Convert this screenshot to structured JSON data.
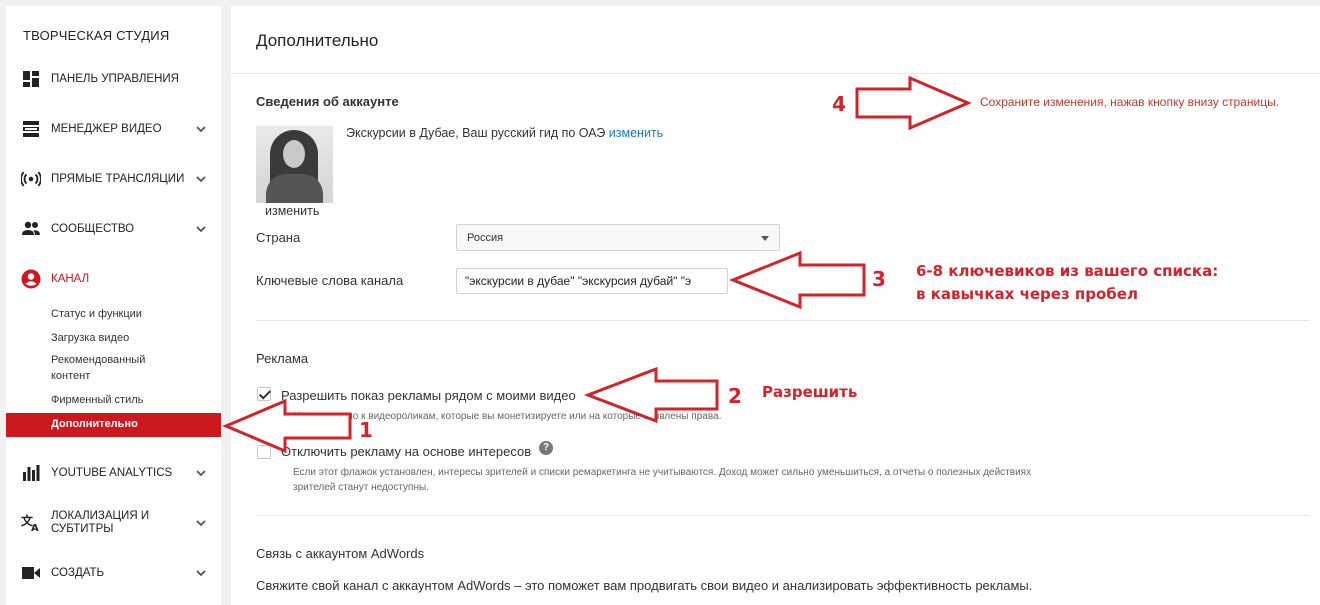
{
  "sidebar": {
    "studio_title": "ТВОРЧЕСКАЯ СТУДИЯ",
    "items": [
      {
        "label": "ПАНЕЛЬ УПРАВЛЕНИЯ",
        "icon": "dashboard-icon"
      },
      {
        "label": "МЕНЕДЖЕР ВИДЕО",
        "icon": "video-manager-icon"
      },
      {
        "label": "ПРЯМЫЕ ТРАНСЛЯЦИИ",
        "icon": "live-broadcast-icon"
      },
      {
        "label": "СООБЩЕСТВО",
        "icon": "community-icon"
      },
      {
        "label": "КАНАЛ",
        "icon": "channel-icon"
      },
      {
        "label": "YOUTUBE ANALYTICS",
        "icon": "analytics-icon"
      },
      {
        "label": "ЛОКАЛИЗАЦИЯ И СУБТИТРЫ",
        "icon": "translate-icon"
      },
      {
        "label": "СОЗДАТЬ",
        "icon": "create-video-icon"
      }
    ],
    "channel_subitems": [
      "Статус и функции",
      "Загрузка видео",
      "Рекомендованный контент",
      "Фирменный стиль"
    ],
    "active_subitem": "Дополнительно"
  },
  "main": {
    "page_title": "Дополнительно",
    "account_section_title": "Сведения об аккаунте",
    "channel_name": "Экскурсии в Дубае, Ваш русский гид по ОАЭ",
    "change_link": "изменить",
    "avatar_change_link": "изменить",
    "country_label": "Страна",
    "country_value": "Россия",
    "keywords_label": "Ключевые слова канала",
    "keywords_value": "\"экскурсии в дубае\" \"экскурсия дубай\" \"э",
    "ads_section_title": "Реклама",
    "allow_ads_label": "Разрешить показ рекламы рядом с моими видео",
    "allow_ads_checked": true,
    "allow_ads_note": "Неприменимо к видеороликам, которые вы монетизируете или на которые заявлены права.",
    "interest_ads_label": "Отключить рекламу на основе интересов",
    "interest_ads_checked": false,
    "interest_ads_note_1": "Если этот флажок установлен, интересы зрителей и списки ремаркетинга не учитываются. Доход может сильно уменьшиться, а отчеты о полезных действиях",
    "interest_ads_note_2": "зрителей станут недоступны.",
    "adwords_section_title": "Связь с аккаунтом AdWords",
    "adwords_text": "Свяжите свой канал с аккаунтом AdWords – это поможет вам продвигать свои видео и анализировать эффективность рекламы."
  },
  "annotations": {
    "n1": "1",
    "n2": "2",
    "n2_text": "Разрешить",
    "n3": "3",
    "n3_text_1": "6-8 ключевиков из вашего списка:",
    "n3_text_2": "в кавычках через пробел",
    "n4": "4",
    "n4_text": "Сохраните изменения, нажав кнопку внизу страницы.",
    "color": "#d2232a"
  }
}
